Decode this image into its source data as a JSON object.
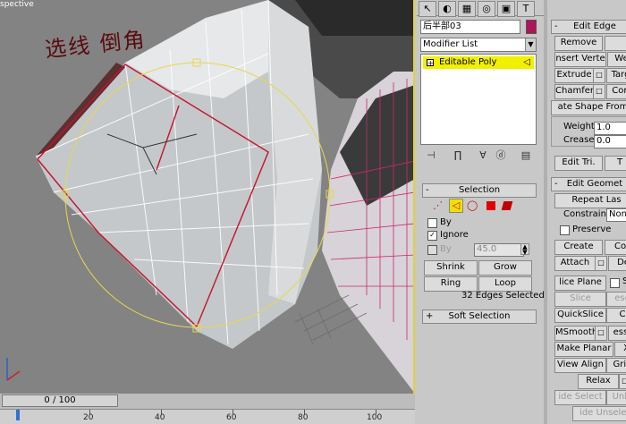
{
  "viewport": {
    "label": "spective",
    "calligraphy": "选线 倒角"
  },
  "timeline": {
    "slider_text": "0 / 100",
    "ticks": [
      "20",
      "40",
      "60",
      "80",
      "100"
    ]
  },
  "command_panel": {
    "tabs": [
      {
        "icon": "pointer-icon",
        "glyph": "↖"
      },
      {
        "icon": "modify-icon",
        "glyph": "◐"
      },
      {
        "icon": "hierarchy-icon",
        "glyph": "▦"
      },
      {
        "icon": "motion-icon",
        "glyph": "◎"
      },
      {
        "icon": "display-icon",
        "glyph": "▣"
      },
      {
        "icon": "utilities-icon",
        "glyph": "T"
      }
    ],
    "object_name": "后半部03",
    "object_color": "#b0145a",
    "modifier_list": "Modifier List",
    "stack_item": "Editable Poly"
  },
  "selection": {
    "title": "Selection",
    "by_vertex_label": "By",
    "ignore_label": "Ignore",
    "by_angle_label": "By",
    "angle_value": "45.0",
    "shrink": "Shrink",
    "grow": "Grow",
    "ring": "Ring",
    "loop": "Loop",
    "status": "32 Edges Selected",
    "soft_selection": "Soft Selection"
  },
  "edit_edges": {
    "title": "Edit Edge",
    "remove": "Remove",
    "insert_vertex": "nsert Verte",
    "weld": "We",
    "extrude": "Extrude",
    "target": "Targ",
    "chamfer": "Chamfer",
    "connect": "Con",
    "create_shape": "ate Shape From",
    "weight_label": "Weight:",
    "weight_value": "1.0",
    "crease_label": "Crease:",
    "crease_value": "0.0",
    "edit_tri": "Edit Tri.",
    "turn": "T"
  },
  "edit_geometry": {
    "title": "Edit Geomet",
    "repeat_last": "Repeat Las",
    "constraints_label": "Constraints:",
    "constraints_value": "None",
    "preserve": "Preserve",
    "create": "Create",
    "collapse": "Col",
    "attach": "Attach",
    "detach": "De",
    "slice_plane": "lice Plane",
    "split": "S",
    "slice": "Slice",
    "reset": "ese",
    "quickslice": "QuickSlice",
    "cut": "C",
    "msmooth": "MSmooth",
    "tessellate": "esse",
    "make_planar": "Make Planar",
    "x": "X",
    "view_align": "View Align",
    "grid": "Grid",
    "relax": "Relax",
    "hide_selected": "ide Select",
    "unhide": "Unhi",
    "hide_unselected": "ide Unselec"
  }
}
